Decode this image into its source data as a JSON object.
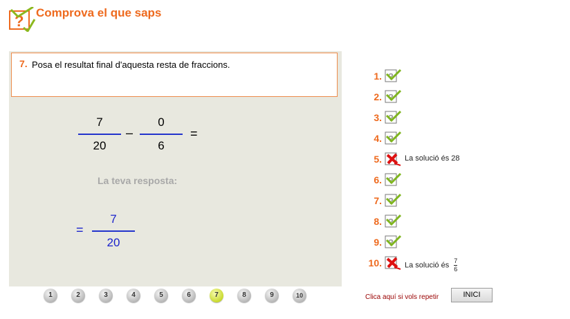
{
  "header": {
    "title": "Comprova el que saps",
    "icon": "question-check-icon"
  },
  "question": {
    "number": "7.",
    "text": "Posa el resultat final d'aquesta resta de fraccions."
  },
  "expression": {
    "fraction1": {
      "numerator": "7",
      "denominator": "20"
    },
    "operator": "–",
    "fraction2": {
      "numerator": "0",
      "denominator": "6"
    },
    "equals": "="
  },
  "answer": {
    "label": "La teva resposta:",
    "equals": "=",
    "numerator": "7",
    "denominator": "20"
  },
  "results": [
    {
      "number": "1.",
      "status": "correct"
    },
    {
      "number": "2.",
      "status": "correct"
    },
    {
      "number": "3.",
      "status": "correct"
    },
    {
      "number": "4.",
      "status": "correct"
    },
    {
      "number": "5.",
      "status": "wrong",
      "note": "La solució és 28"
    },
    {
      "number": "6.",
      "status": "correct"
    },
    {
      "number": "7.",
      "status": "correct"
    },
    {
      "number": "8.",
      "status": "correct"
    },
    {
      "number": "9.",
      "status": "correct"
    },
    {
      "number": "10.",
      "status": "wrong",
      "note": "La solució és",
      "note_fraction": {
        "numerator": "7",
        "denominator": "6"
      }
    }
  ],
  "nav": {
    "buttons": [
      "1",
      "2",
      "3",
      "4",
      "5",
      "6",
      "7",
      "8",
      "9",
      "10"
    ],
    "active": "7"
  },
  "footer": {
    "repeat_text": "Clica aquí si vols repetir",
    "start_label": "INICI"
  },
  "colors": {
    "accent": "#ee6a1e",
    "fraction_bar": "#2233cc",
    "answer": "#1a22cc",
    "panel": "#e8e8df"
  }
}
